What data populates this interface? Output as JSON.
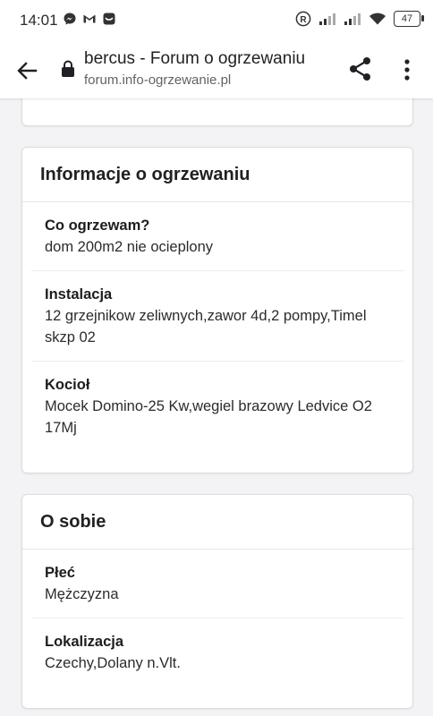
{
  "status_bar": {
    "time": "14:01",
    "battery": "47",
    "icons_left": [
      "messenger-icon",
      "gmail-icon",
      "chat-icon"
    ],
    "icons_right": [
      "registered-icon",
      "signal-icon",
      "signal-icon",
      "wifi-icon",
      "battery-icon"
    ]
  },
  "toolbar": {
    "title": "bercus - Forum o ogrzewaniu",
    "url": "forum.info-ogrzewanie.pl"
  },
  "heating_card": {
    "title": "Informacje o ogrzewaniu",
    "fields": [
      {
        "label": "Co ogrzewam?",
        "value": "dom 200m2 nie ocieplony"
      },
      {
        "label": "Instalacja",
        "value": "12 grzejnikow zeliwnych,zawor 4d,2 pompy,Timel skzp 02"
      },
      {
        "label": "Kocioł",
        "value": "Mocek Domino-25 Kw,wegiel brazowy Ledvice O2 17Mj"
      }
    ]
  },
  "about_card": {
    "title": "O sobie",
    "fields": [
      {
        "label": "Płeć",
        "value": "Mężczyzna"
      },
      {
        "label": "Lokalizacja",
        "value": "Czechy,Dolany n.Vlt."
      }
    ]
  }
}
